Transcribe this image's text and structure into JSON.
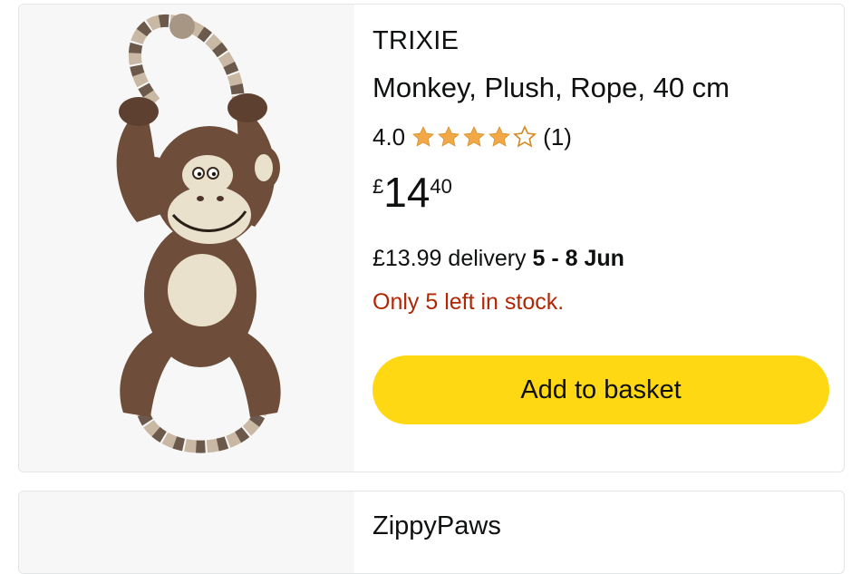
{
  "products": [
    {
      "brand": "TRIXIE",
      "title": "Monkey, Plush, Rope, 40 cm",
      "rating_value": "4.0",
      "rating_stars": 4,
      "rating_count": "(1)",
      "price_currency": "£",
      "price_whole": "14",
      "price_fraction": "40",
      "delivery_price": "£13.99 delivery",
      "delivery_dates": "5 - 8 Jun",
      "stock_message": "Only 5 left in stock.",
      "add_button_label": "Add to basket",
      "image_icon": "monkey-plush-toy-image"
    },
    {
      "brand": "ZippyPaws"
    }
  ],
  "colors": {
    "star": "#f3a847",
    "stock": "#b12704",
    "button": "#ffd814",
    "image_bg": "#f7f7f7"
  }
}
